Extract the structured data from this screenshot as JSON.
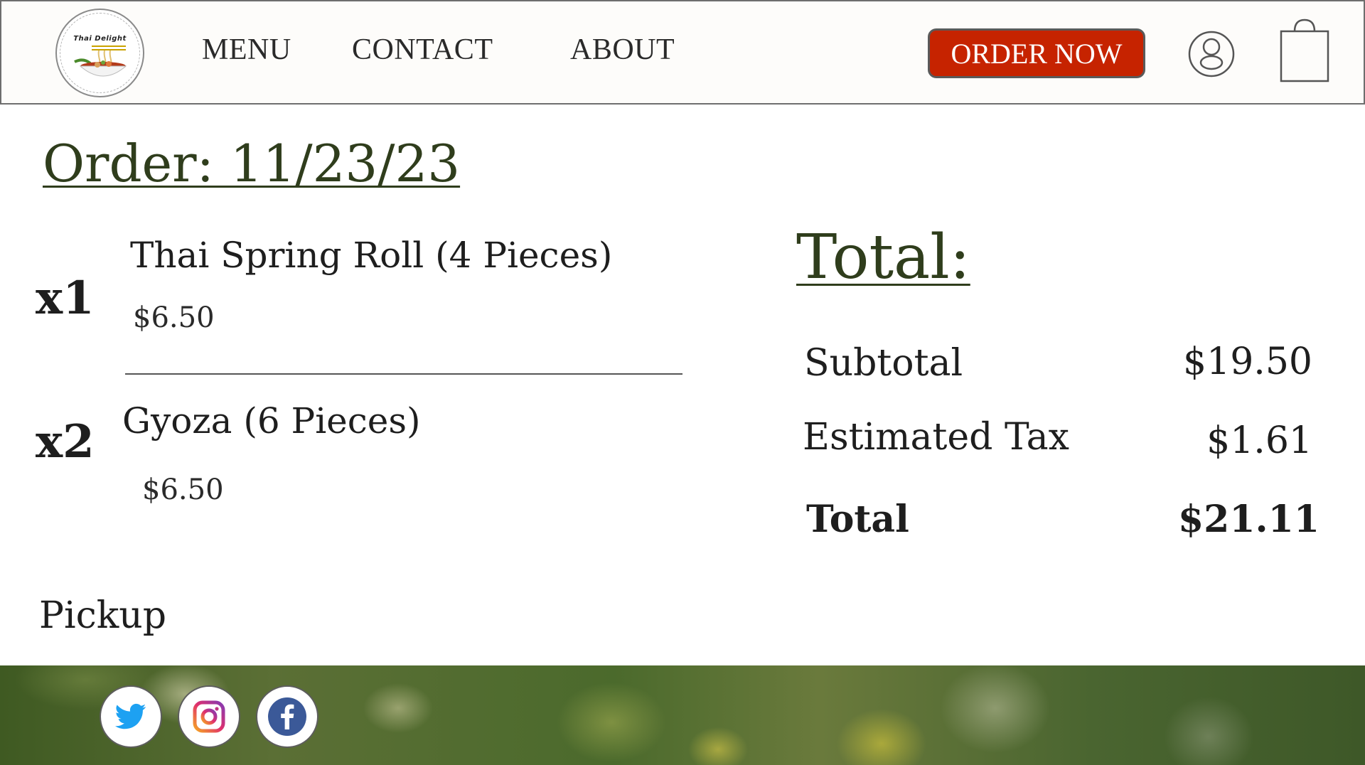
{
  "header": {
    "logo_text": "Thai Delight",
    "nav": [
      "MENU",
      "CONTACT",
      "ABOUT"
    ],
    "order_button": "ORDER NOW",
    "icons": [
      "user-icon",
      "shopping-bag-icon"
    ]
  },
  "order": {
    "title": "Order: 11/23/23",
    "items": [
      {
        "qty": "x1",
        "name": "Thai Spring Roll (4 Pieces)",
        "price": "$6.50"
      },
      {
        "qty": "x2",
        "name": "Gyoza (6 Pieces)",
        "price": "$6.50"
      }
    ],
    "fulfillment": "Pickup"
  },
  "summary": {
    "title": "Total:",
    "subtotal_label": "Subtotal",
    "subtotal_value": "$19.50",
    "tax_label": "Estimated Tax",
    "tax_value": "$1.61",
    "total_label": "Total",
    "total_value": "$21.11"
  },
  "footer": {
    "social_icons": [
      "twitter-icon",
      "instagram-icon",
      "facebook-icon"
    ]
  },
  "colors": {
    "accent": "#c62300",
    "heading_green": "#2f3d1c",
    "twitter": "#1da1f2",
    "facebook": "#3b5998"
  }
}
